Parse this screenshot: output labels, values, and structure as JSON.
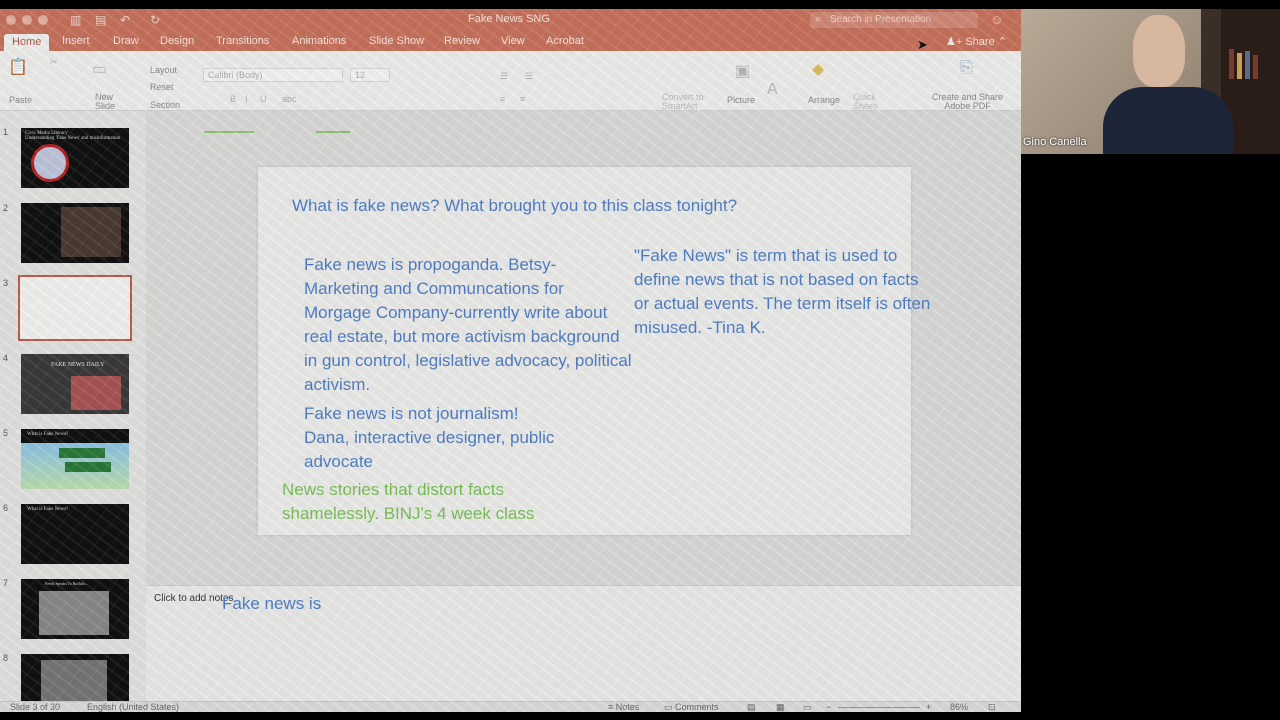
{
  "titlebar": {
    "doc_title": "Fake News SNG",
    "search_placeholder": "Search in Presentation"
  },
  "tabs": [
    {
      "label": "Home",
      "active": true
    },
    {
      "label": "Insert"
    },
    {
      "label": "Draw"
    },
    {
      "label": "Design"
    },
    {
      "label": "Transitions"
    },
    {
      "label": "Animations"
    },
    {
      "label": "Slide Show"
    },
    {
      "label": "Review"
    },
    {
      "label": "View"
    },
    {
      "label": "Acrobat"
    }
  ],
  "share_label": "Share",
  "ribbon": {
    "paste": "Paste",
    "new_slide": "New\nSlide",
    "layout": "Layout",
    "reset": "Reset",
    "section": "Section",
    "font_name": "Calibri (Body)",
    "font_size": "12",
    "convert_smartart": "Convert to\nSmartArt",
    "picture": "Picture",
    "arrange": "Arrange",
    "quick_styles": "Quick\nStyles",
    "create_share_pdf": "Create and Share\nAdobe PDF"
  },
  "thumbnails": [
    {
      "num": "1",
      "caption": "Civic Media Literacy\nUnderstanding 'Fake News' and misinformation"
    },
    {
      "num": "2",
      "caption": ""
    },
    {
      "num": "3",
      "caption": ""
    },
    {
      "num": "4",
      "caption": "FAKE NEWS DAILY"
    },
    {
      "num": "5",
      "caption": "What is Fake News?"
    },
    {
      "num": "6",
      "caption": "What is Fake News?"
    },
    {
      "num": "7",
      "caption": "Feeds Speaks To Buffalo..."
    },
    {
      "num": "8",
      "caption": ""
    }
  ],
  "slide": {
    "question": "What is fake news? What brought you to this class tonight?",
    "responses": {
      "betsy": "Fake news is propoganda. Betsy- Marketing and Communcations for Morgage Company-currently write about real estate, but more activism background in gun control, legislative advocacy, political activism.",
      "tina": "\"Fake News\" is term that is used to define news that is not based on facts or actual events. The term itself is often  misused. -Tina K.",
      "dana": "Fake news is not journalism! Dana, interactive designer, public advocate",
      "binj": "News stories that distort facts shamelessly. BINJ's 4 week class"
    }
  },
  "notes": {
    "placeholder": "Click to add notes",
    "text": "Fake news is"
  },
  "status": {
    "slide_count": "Slide 3 of 30",
    "language": "English (United States)",
    "notes_btn": "Notes",
    "comments_btn": "Comments",
    "zoom": "86%"
  },
  "video": {
    "participant": "Gino Canella"
  },
  "colors": {
    "titlebar": "#c9735d",
    "slide_text_blue": "#4f7fc7",
    "slide_text_green": "#79c257",
    "selected_thumb_border": "#c45c4a"
  }
}
